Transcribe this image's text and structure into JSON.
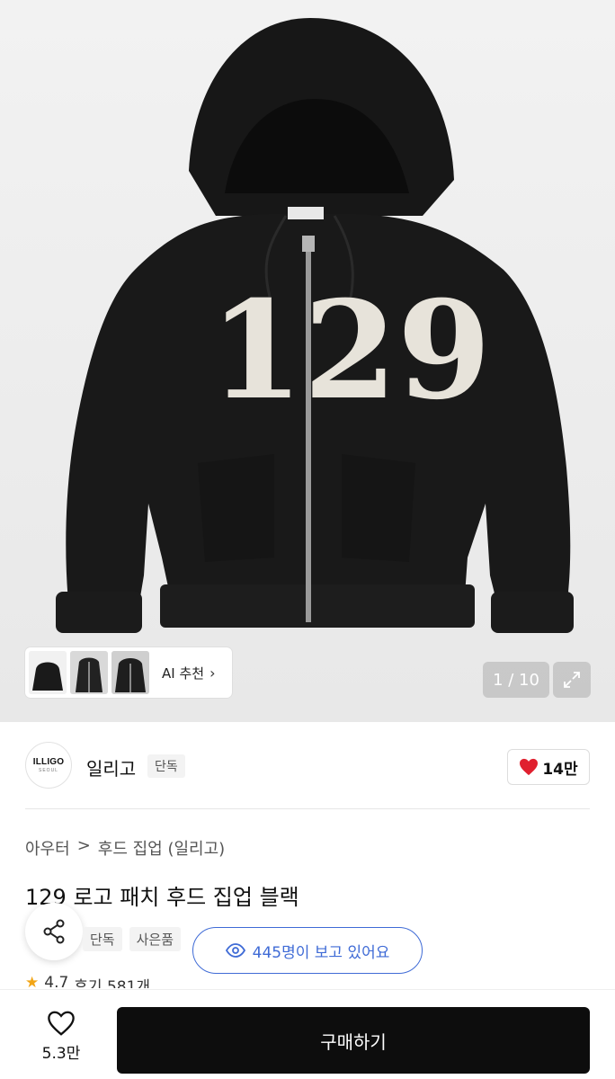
{
  "gallery": {
    "ai_recommend_label": "AI 추천",
    "counter": "1 / 10",
    "patch_text": "129"
  },
  "seller": {
    "logo_text": "ILLIGO",
    "logo_sub": "SEOUL",
    "name": "일리고",
    "tag": "단독",
    "like_count": "14만"
  },
  "breadcrumb": {
    "category": "아우터",
    "separator": ">",
    "subcategory": "후드 집업 (일리고)"
  },
  "product": {
    "title": "129 로고 패치 후드 집업 블랙",
    "badges": [
      "단독",
      "사은품"
    ],
    "viewers": "445명이 보고 있어요",
    "rating": "4.7",
    "reviews": "후기 581개"
  },
  "bottom_bar": {
    "wish_count": "5.3만",
    "buy_label": "구매하기"
  },
  "colors": {
    "accent_blue": "#3f6bd6",
    "heart_red": "#e0202f",
    "buy_black": "#0d0d0d"
  }
}
